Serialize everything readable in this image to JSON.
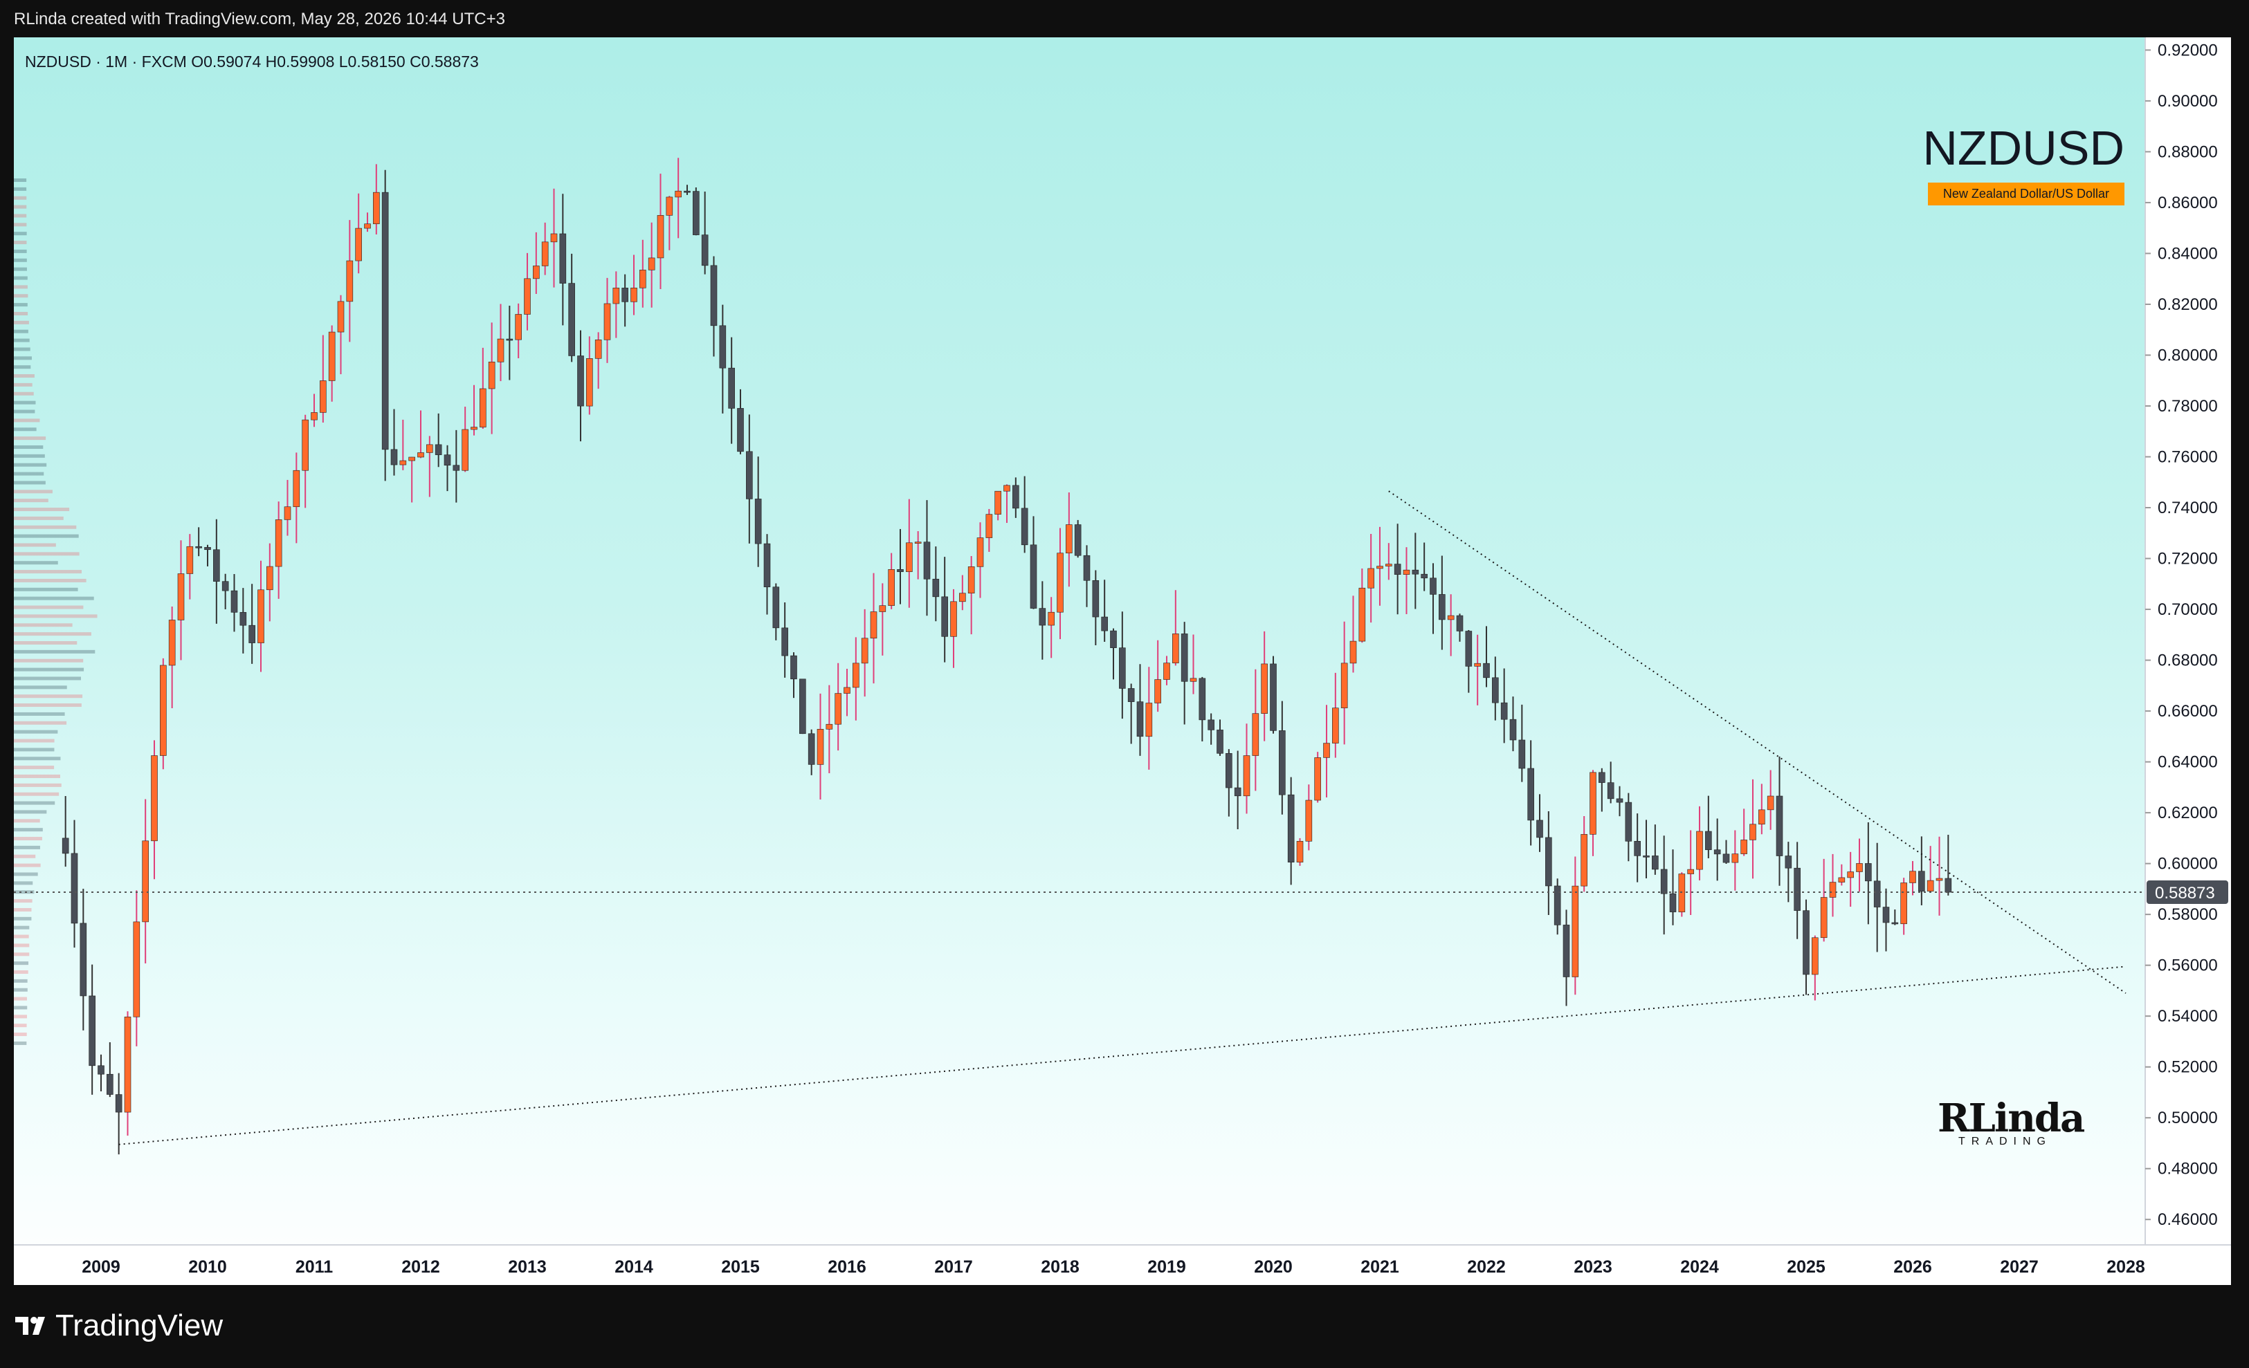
{
  "header": {
    "attribution": "RLinda created with TradingView.com, May 28, 2026 10:44 UTC+3"
  },
  "legend": {
    "text": "NZDUSD · 1M · FXCM  O0.59074  H0.59908  L0.58150  C0.58873"
  },
  "symbol": {
    "ticker": "NZDUSD",
    "description": "New Zealand Dollar/US Dollar"
  },
  "watermark": {
    "logo": "RLinda",
    "sub": "TRADING"
  },
  "footer": {
    "brand": "TradingView"
  },
  "price_label": "0.58873",
  "colors": {
    "up": "#ff6a2b",
    "down": "#4a4f58",
    "accent": "#ff9800",
    "axis_bg": "#ffffff"
  },
  "chart_data": {
    "type": "candlestick",
    "interval": "1M",
    "ylim": [
      0.45,
      0.925
    ],
    "y_ticks": [
      "0.46000",
      "0.48000",
      "0.50000",
      "0.52000",
      "0.54000",
      "0.56000",
      "0.58000",
      "0.60000",
      "0.62000",
      "0.64000",
      "0.66000",
      "0.68000",
      "0.70000",
      "0.72000",
      "0.74000",
      "0.76000",
      "0.78000",
      "0.80000",
      "0.82000",
      "0.84000",
      "0.86000",
      "0.88000",
      "0.90000",
      "0.92000"
    ],
    "x_ticks": [
      "2009",
      "2010",
      "2011",
      "2012",
      "2013",
      "2014",
      "2015",
      "2016",
      "2017",
      "2018",
      "2019",
      "2020",
      "2021",
      "2022",
      "2023",
      "2024",
      "2025",
      "2026",
      "2027",
      "2028"
    ],
    "last_close": 0.58873,
    "trendlines": [
      {
        "name": "descending resistance",
        "from": [
          "2021-02",
          0.7465
        ],
        "to": [
          "2028-01",
          0.549
        ]
      },
      {
        "name": "ascending support",
        "from": [
          "2009-03",
          0.4895
        ],
        "to": [
          "2028-01",
          0.5595
        ]
      }
    ],
    "anchors": [
      {
        "d": "2008-09",
        "p": 0.61
      },
      {
        "d": "2008-12",
        "p": 0.52
      },
      {
        "d": "2009-03",
        "p": 0.5
      },
      {
        "d": "2009-08",
        "p": 0.68
      },
      {
        "d": "2009-11",
        "p": 0.73
      },
      {
        "d": "2010-06",
        "p": 0.69
      },
      {
        "d": "2010-12",
        "p": 0.77
      },
      {
        "d": "2011-08",
        "p": 0.87
      },
      {
        "d": "2011-09",
        "p": 0.76
      },
      {
        "d": "2012-05",
        "p": 0.76
      },
      {
        "d": "2013-04",
        "p": 0.85
      },
      {
        "d": "2013-07",
        "p": 0.78
      },
      {
        "d": "2013-10",
        "p": 0.82
      },
      {
        "d": "2014-01",
        "p": 0.83
      },
      {
        "d": "2014-07",
        "p": 0.87
      },
      {
        "d": "2014-12",
        "p": 0.78
      },
      {
        "d": "2015-06",
        "p": 0.68
      },
      {
        "d": "2015-09",
        "p": 0.64
      },
      {
        "d": "2016-06",
        "p": 0.71
      },
      {
        "d": "2016-09",
        "p": 0.73
      },
      {
        "d": "2016-12",
        "p": 0.69
      },
      {
        "d": "2017-07",
        "p": 0.75
      },
      {
        "d": "2017-11",
        "p": 0.69
      },
      {
        "d": "2018-02",
        "p": 0.73
      },
      {
        "d": "2018-10",
        "p": 0.65
      },
      {
        "d": "2019-02",
        "p": 0.685
      },
      {
        "d": "2019-09",
        "p": 0.627
      },
      {
        "d": "2019-12",
        "p": 0.673
      },
      {
        "d": "2020-03",
        "p": 0.6
      },
      {
        "d": "2020-12",
        "p": 0.72
      },
      {
        "d": "2021-02",
        "p": 0.72
      },
      {
        "d": "2021-08",
        "p": 0.7
      },
      {
        "d": "2022-04",
        "p": 0.65
      },
      {
        "d": "2022-10",
        "p": 0.56
      },
      {
        "d": "2023-01",
        "p": 0.64
      },
      {
        "d": "2023-10",
        "p": 0.58
      },
      {
        "d": "2024-01",
        "p": 0.61
      },
      {
        "d": "2024-04",
        "p": 0.595
      },
      {
        "d": "2024-09",
        "p": 0.625
      },
      {
        "d": "2025-01",
        "p": 0.56
      },
      {
        "d": "2025-04",
        "p": 0.595
      },
      {
        "d": "2025-07",
        "p": 0.6
      },
      {
        "d": "2025-10",
        "p": 0.575
      },
      {
        "d": "2026-01",
        "p": 0.595
      },
      {
        "d": "2026-05",
        "p": 0.5887
      }
    ]
  }
}
